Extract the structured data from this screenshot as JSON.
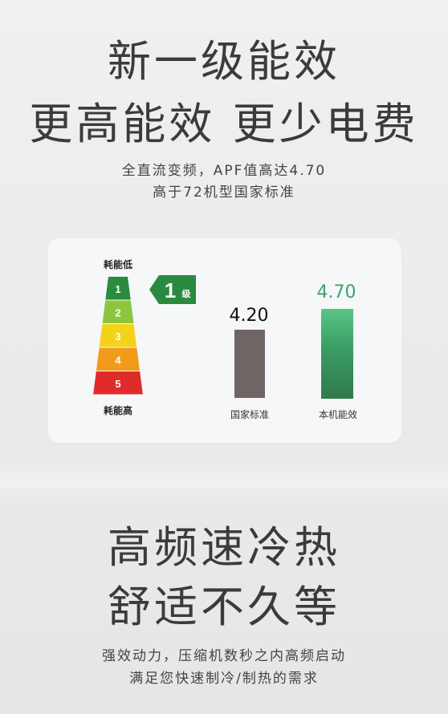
{
  "headline": {
    "line1": "新一级能效",
    "line2": "更高能效 更少电费"
  },
  "subtitle": {
    "line1": "全直流变频，APF值高达4.70",
    "line2": "高于72机型国家标准"
  },
  "efficiency_card": {
    "label_low": "耗能低",
    "label_high": "耗能高",
    "grades": [
      {
        "num": "1",
        "color": "#2a8a3e"
      },
      {
        "num": "2",
        "color": "#8cc63f"
      },
      {
        "num": "3",
        "color": "#f4d21a"
      },
      {
        "num": "4",
        "color": "#f29b1b"
      },
      {
        "num": "5",
        "color": "#e02b2b"
      }
    ],
    "grade_badge": {
      "num": "1",
      "unit": "级",
      "color": "#2a8a3e"
    },
    "chart_data": {
      "type": "bar",
      "categories": [
        "国家标准",
        "本机能效"
      ],
      "values": [
        4.2,
        4.7
      ],
      "value_labels": [
        "4.20",
        "4.70"
      ],
      "colors": [
        "#6e6564",
        "#3a9c63"
      ]
    }
  },
  "section2": {
    "headline_line1": "高频速冷热",
    "headline_line2": "舒适不久等",
    "subtitle_line1": "强效动力，压缩机数秒之内高频启动",
    "subtitle_line2": "满足您快速制冷/制热的需求"
  }
}
